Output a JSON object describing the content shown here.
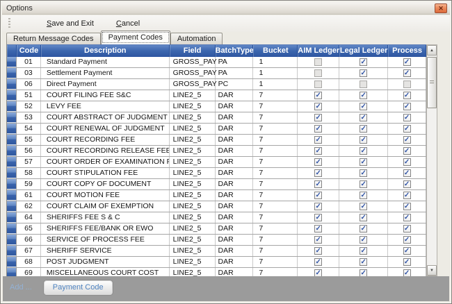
{
  "window": {
    "title": "Options"
  },
  "icons": {
    "close": "✕",
    "check": "✓",
    "scroll_up": "▲",
    "scroll_down": "▼"
  },
  "colors": {
    "header_blue": "#3c66ae",
    "close_orange": "#dd6a3a",
    "footer_gray": "#9b9b9b",
    "link_blue": "#4e82bf"
  },
  "menu": {
    "items": [
      {
        "accel": "S",
        "rest": "ave and Exit"
      },
      {
        "accel": "C",
        "rest": "ancel"
      }
    ]
  },
  "tabs": [
    {
      "label": "Return Message Codes",
      "selected": false
    },
    {
      "label": "Payment Codes",
      "selected": true
    },
    {
      "label": "Automation",
      "selected": false
    }
  ],
  "grid": {
    "columns": [
      "Code",
      "Description",
      "Field",
      "BatchType",
      "Bucket",
      "AIM Ledger",
      "Legal Ledger",
      "Process"
    ],
    "rows": [
      {
        "code": "01",
        "description": "Standard Payment",
        "field": "GROSS_PAY",
        "batch_type": "PA",
        "bucket": "1",
        "aim_ledger": false,
        "legal_ledger": true,
        "process": true
      },
      {
        "code": "03",
        "description": "Settlement Payment",
        "field": "GROSS_PAY",
        "batch_type": "PA",
        "bucket": "1",
        "aim_ledger": false,
        "legal_ledger": true,
        "process": true
      },
      {
        "code": "06",
        "description": "Direct Payment",
        "field": "GROSS_PAY",
        "batch_type": "PC",
        "bucket": "1",
        "aim_ledger": false,
        "legal_ledger": false,
        "process": false
      },
      {
        "code": "51",
        "description": "COURT FILING FEE S&C",
        "field": "LINE2_5",
        "batch_type": "DAR",
        "bucket": "7",
        "aim_ledger": true,
        "legal_ledger": true,
        "process": true
      },
      {
        "code": "52",
        "description": "LEVY FEE",
        "field": "LINE2_5",
        "batch_type": "DAR",
        "bucket": "7",
        "aim_ledger": true,
        "legal_ledger": true,
        "process": true
      },
      {
        "code": "53",
        "description": "COURT ABSTRACT OF JUDGMENT",
        "field": "LINE2_5",
        "batch_type": "DAR",
        "bucket": "7",
        "aim_ledger": true,
        "legal_ledger": true,
        "process": true
      },
      {
        "code": "54",
        "description": "COURT RENEWAL OF JUDGMENT",
        "field": "LINE2_5",
        "batch_type": "DAR",
        "bucket": "7",
        "aim_ledger": true,
        "legal_ledger": true,
        "process": true
      },
      {
        "code": "55",
        "description": "COURT RECORDING FEE",
        "field": "LINE2_5",
        "batch_type": "DAR",
        "bucket": "7",
        "aim_ledger": true,
        "legal_ledger": true,
        "process": true
      },
      {
        "code": "56",
        "description": "COURT RECORDING RELEASE FEE",
        "field": "LINE2_5",
        "batch_type": "DAR",
        "bucket": "7",
        "aim_ledger": true,
        "legal_ledger": true,
        "process": true
      },
      {
        "code": "57",
        "description": "COURT ORDER OF EXAMINATION FEE",
        "field": "LINE2_5",
        "batch_type": "DAR",
        "bucket": "7",
        "aim_ledger": true,
        "legal_ledger": true,
        "process": true
      },
      {
        "code": "58",
        "description": "COURT STIPULATION FEE",
        "field": "LINE2_5",
        "batch_type": "DAR",
        "bucket": "7",
        "aim_ledger": true,
        "legal_ledger": true,
        "process": true
      },
      {
        "code": "59",
        "description": "COURT COPY OF DOCUMENT",
        "field": "LINE2_5",
        "batch_type": "DAR",
        "bucket": "7",
        "aim_ledger": true,
        "legal_ledger": true,
        "process": true
      },
      {
        "code": "61",
        "description": "COURT MOTION FEE",
        "field": "LINE2_5",
        "batch_type": "DAR",
        "bucket": "7",
        "aim_ledger": true,
        "legal_ledger": true,
        "process": true
      },
      {
        "code": "62",
        "description": "COURT CLAIM OF EXEMPTION",
        "field": "LINE2_5",
        "batch_type": "DAR",
        "bucket": "7",
        "aim_ledger": true,
        "legal_ledger": true,
        "process": true
      },
      {
        "code": "64",
        "description": "SHERIFFS FEE S & C",
        "field": "LINE2_5",
        "batch_type": "DAR",
        "bucket": "7",
        "aim_ledger": true,
        "legal_ledger": true,
        "process": true
      },
      {
        "code": "65",
        "description": "SHERIFFS FEE/BANK OR EWO",
        "field": "LINE2_5",
        "batch_type": "DAR",
        "bucket": "7",
        "aim_ledger": true,
        "legal_ledger": true,
        "process": true
      },
      {
        "code": "66",
        "description": "SERVICE OF PROCESS FEE",
        "field": "LINE2_5",
        "batch_type": "DAR",
        "bucket": "7",
        "aim_ledger": true,
        "legal_ledger": true,
        "process": true
      },
      {
        "code": "67",
        "description": "SHERIFF SERVICE",
        "field": "LINE2_5",
        "batch_type": "DAR",
        "bucket": "7",
        "aim_ledger": true,
        "legal_ledger": true,
        "process": true
      },
      {
        "code": "68",
        "description": "POST JUDGMENT",
        "field": "LINE2_5",
        "batch_type": "DAR",
        "bucket": "7",
        "aim_ledger": true,
        "legal_ledger": true,
        "process": true
      },
      {
        "code": "69",
        "description": "MISCELLANEOUS COURT COST",
        "field": "LINE2_5",
        "batch_type": "DAR",
        "bucket": "7",
        "aim_ledger": true,
        "legal_ledger": true,
        "process": true
      }
    ]
  },
  "footer": {
    "add_label": "Add ...",
    "button_label": "Payment Code"
  }
}
